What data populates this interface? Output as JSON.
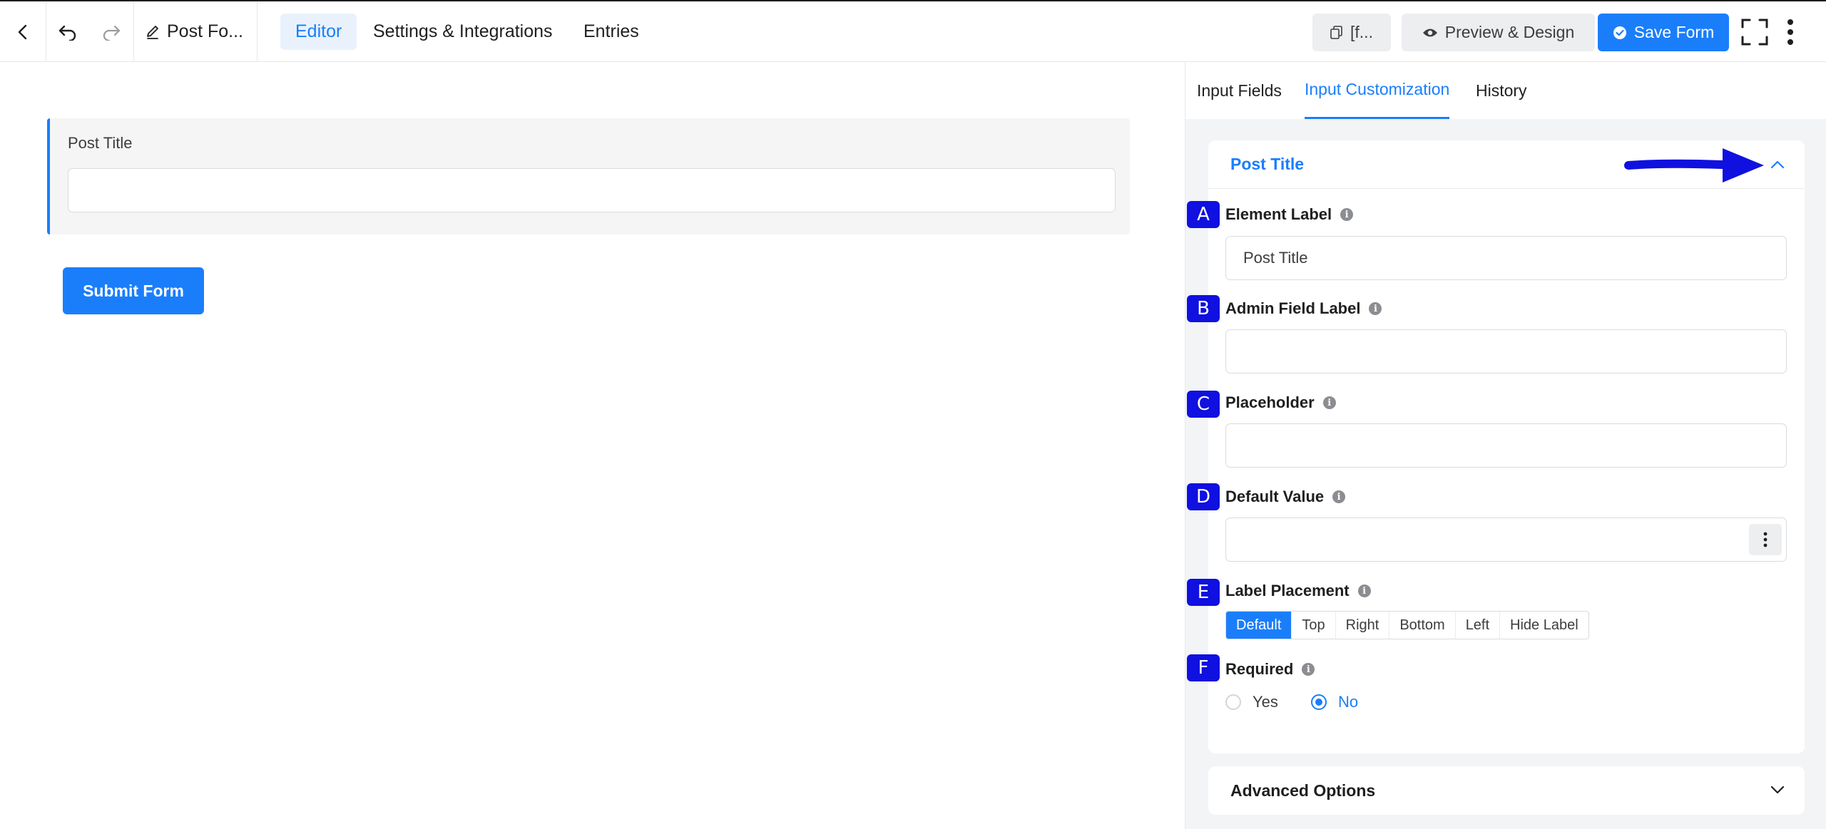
{
  "topbar": {
    "form_title": "Post Fo...",
    "tabs": [
      {
        "label": "Editor",
        "active": true
      },
      {
        "label": "Settings & Integrations",
        "active": false
      },
      {
        "label": "Entries",
        "active": false
      }
    ],
    "shortcode_label": "[f...",
    "preview_label": "Preview & Design",
    "save_label": "Save Form"
  },
  "canvas": {
    "field_label": "Post Title",
    "submit_label": "Submit Form"
  },
  "panel": {
    "tabs": [
      {
        "label": "Input Fields",
        "active": false
      },
      {
        "label": "Input Customization",
        "active": true
      },
      {
        "label": "History",
        "active": false
      }
    ],
    "section_title": "Post Title",
    "fields": {
      "element_label": {
        "badge": "A",
        "label": "Element Label",
        "value": "Post Title"
      },
      "admin_label": {
        "badge": "B",
        "label": "Admin Field Label",
        "value": ""
      },
      "placeholder": {
        "badge": "C",
        "label": "Placeholder",
        "value": ""
      },
      "default_value": {
        "badge": "D",
        "label": "Default Value",
        "value": ""
      },
      "label_placement": {
        "badge": "E",
        "label": "Label Placement",
        "options": [
          "Default",
          "Top",
          "Right",
          "Bottom",
          "Left",
          "Hide Label"
        ],
        "selected": "Default"
      },
      "required": {
        "badge": "F",
        "label": "Required",
        "options": [
          "Yes",
          "No"
        ],
        "selected": "No"
      }
    },
    "advanced_title": "Advanced Options"
  },
  "colors": {
    "accent": "#1a7efb",
    "badge": "#1010e0",
    "arrow": "#1010e0"
  }
}
